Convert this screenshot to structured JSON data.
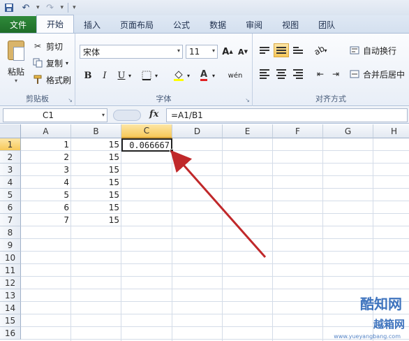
{
  "quick_access": {
    "undo_icon": "undo-icon",
    "redo_icon": "redo-icon",
    "save_icon": "save-icon"
  },
  "tabs": [
    {
      "label": "文件"
    },
    {
      "label": "开始"
    },
    {
      "label": "插入"
    },
    {
      "label": "页面布局"
    },
    {
      "label": "公式"
    },
    {
      "label": "数据"
    },
    {
      "label": "审阅"
    },
    {
      "label": "视图"
    },
    {
      "label": "团队"
    }
  ],
  "ribbon": {
    "clipboard": {
      "paste": "粘贴",
      "cut": "剪切",
      "copy": "复制",
      "format_painter": "格式刷",
      "group": "剪贴板"
    },
    "font": {
      "name": "宋体",
      "size": "11",
      "bold": "B",
      "italic": "I",
      "underline": "U",
      "grow": "A",
      "shrink": "A",
      "group": "字体",
      "wen": "wén"
    },
    "alignment": {
      "wrap": "自动换行",
      "merge": "合并后居中",
      "group": "对齐方式"
    }
  },
  "formula_bar": {
    "name_box": "C1",
    "fx": "fx",
    "formula": "=A1/B1"
  },
  "grid": {
    "columns": [
      "A",
      "B",
      "C",
      "D",
      "E",
      "F",
      "G",
      "H"
    ],
    "rows": [
      "1",
      "2",
      "3",
      "4",
      "5",
      "6",
      "7",
      "8",
      "9",
      "10",
      "11",
      "12",
      "13",
      "14",
      "15",
      "16"
    ],
    "colA": [
      "1",
      "2",
      "3",
      "4",
      "5",
      "6",
      "7"
    ],
    "colB": [
      "15",
      "15",
      "15",
      "15",
      "15",
      "15",
      "15"
    ],
    "active_value": "0.066667"
  },
  "watermark": {
    "line1": "酷知网",
    "line2": "越箱网",
    "url": "www.yueyangbang.com"
  },
  "colors": {
    "file_tab": "#1f6d29",
    "arrow": "#c0282a",
    "selected_header": "#f7c95a"
  }
}
